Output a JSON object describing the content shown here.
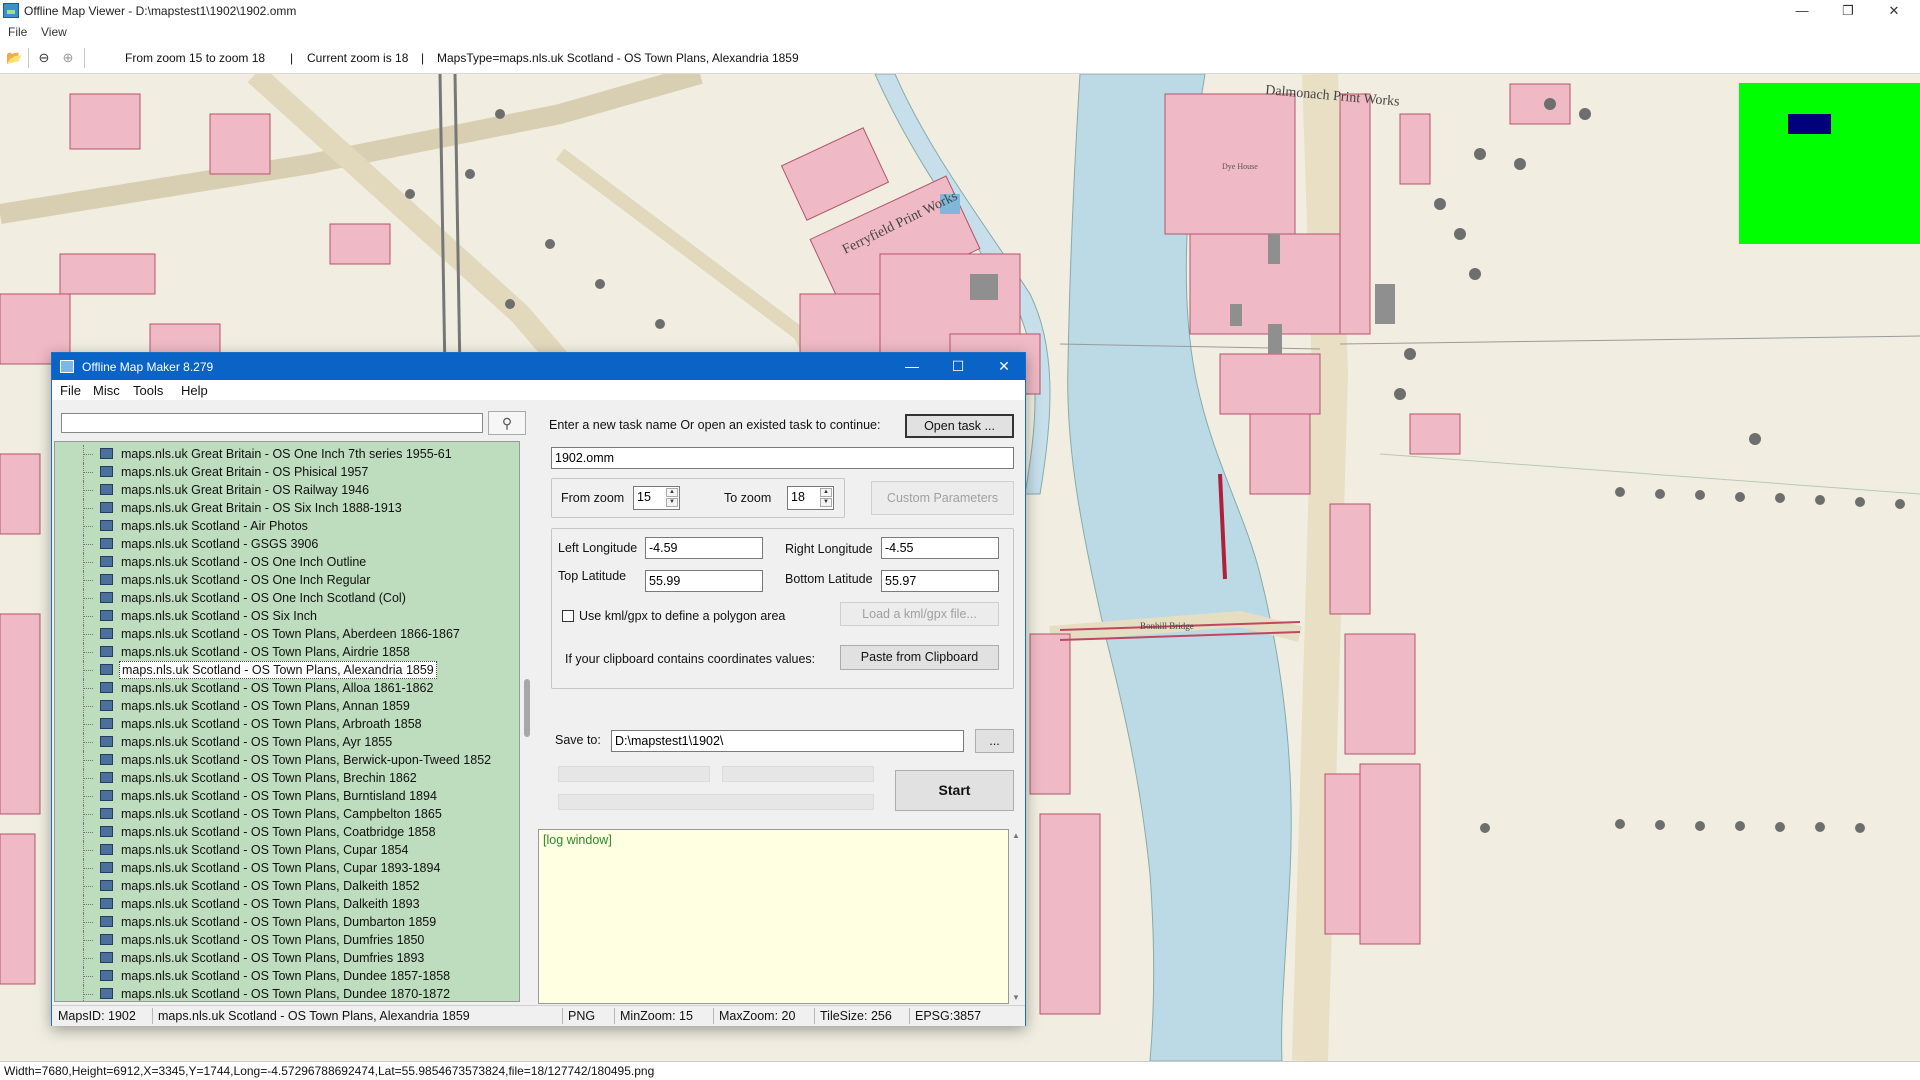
{
  "viewer": {
    "title": "Offline Map Viewer - D:\\mapstest1\\1902\\1902.omm",
    "menu": [
      "File",
      "View"
    ],
    "toolbar": {
      "zoom_range": "From zoom 15 to zoom 18",
      "current_zoom": "Current zoom is 18",
      "maps_type": "MapsType=maps.nls.uk Scotland - OS Town Plans, Alexandria 1859",
      "sep1": "|",
      "sep2": "|"
    },
    "map_labels": {
      "print_works_a": "Dalmonach Print Works",
      "print_works_b": "Ferryfield Print Works",
      "bridge": "Bonhill Bridge",
      "works_small": "Dye House"
    },
    "status": "Width=7680,Height=6912,X=3345,Y=1744,Long=-4.57296788692474,Lat=55.9854673573824,file=18/127742/180495.png",
    "overview_colors": {
      "background": "#00ff00",
      "viewport": "#00007a"
    }
  },
  "dialog": {
    "title": "Offline Map Maker 8.279",
    "menu": [
      "File",
      "Misc",
      "Tools",
      "Help"
    ],
    "search_value": "",
    "maps": [
      "maps.nls.uk Great Britain - OS One Inch 7th series 1955-61",
      "maps.nls.uk Great Britain - OS Phisical 1957",
      "maps.nls.uk Great Britain - OS Railway 1946",
      "maps.nls.uk Great Britain - OS Six Inch 1888-1913",
      "maps.nls.uk Scotland - Air Photos",
      "maps.nls.uk Scotland - GSGS 3906",
      "maps.nls.uk Scotland - OS One Inch Outline",
      "maps.nls.uk Scotland - OS One Inch Regular",
      "maps.nls.uk Scotland - OS One Inch Scotland (Col)",
      "maps.nls.uk Scotland - OS Six Inch",
      "maps.nls.uk Scotland - OS Town Plans, Aberdeen 1866-1867",
      "maps.nls.uk Scotland - OS Town Plans, Airdrie 1858",
      "maps.nls.uk Scotland - OS Town Plans, Alexandria 1859",
      "maps.nls.uk Scotland - OS Town Plans, Alloa 1861-1862",
      "maps.nls.uk Scotland - OS Town Plans, Annan 1859",
      "maps.nls.uk Scotland - OS Town Plans, Arbroath 1858",
      "maps.nls.uk Scotland - OS Town Plans, Ayr 1855",
      "maps.nls.uk Scotland - OS Town Plans, Berwick-upon-Tweed 1852",
      "maps.nls.uk Scotland - OS Town Plans, Brechin 1862",
      "maps.nls.uk Scotland - OS Town Plans, Burntisland 1894",
      "maps.nls.uk Scotland - OS Town Plans, Campbelton 1865",
      "maps.nls.uk Scotland - OS Town Plans, Coatbridge 1858",
      "maps.nls.uk Scotland - OS Town Plans, Cupar 1854",
      "maps.nls.uk Scotland - OS Town Plans, Cupar 1893-1894",
      "maps.nls.uk Scotland - OS Town Plans, Dalkeith 1852",
      "maps.nls.uk Scotland - OS Town Plans, Dalkeith 1893",
      "maps.nls.uk Scotland - OS Town Plans, Dumbarton 1859",
      "maps.nls.uk Scotland - OS Town Plans, Dumfries 1850",
      "maps.nls.uk Scotland - OS Town Plans, Dumfries 1893",
      "maps.nls.uk Scotland - OS Town Plans, Dundee 1857-1858",
      "maps.nls.uk Scotland - OS Town Plans, Dundee 1870-1872"
    ],
    "selected_map": "maps.nls.uk Scotland - OS Town Plans, Alexandria 1859",
    "task_prompt": "Enter a new task name Or open an existed task to continue:",
    "open_task_label": "Open task ...",
    "task_name": "1902.omm",
    "from_zoom_label": "From zoom",
    "from_zoom": "15",
    "to_zoom_label": "To zoom",
    "to_zoom": "18",
    "custom_params_label": "Custom Parameters",
    "left_lon_label": "Left Longitude",
    "left_lon": "-4.59",
    "right_lon_label": "Right Longitude",
    "right_lon": "-4.55",
    "top_lat_label": "Top Latitude",
    "top_lat": "55.99",
    "bottom_lat_label": "Bottom Latitude",
    "bottom_lat": "55.97",
    "kml_label": "Use kml/gpx to define a polygon area",
    "load_kml_label": "Load a kml/gpx file...",
    "clipboard_label": "If your clipboard contains coordinates values:",
    "paste_label": "Paste from Clipboard",
    "save_to_label": "Save to:",
    "save_to": "D:\\mapstest1\\1902\\",
    "browse_label": "...",
    "start_label": "Start",
    "log_text": "[log window]",
    "status": {
      "maps_id": "MapsID: 1902",
      "map_name": "maps.nls.uk Scotland - OS Town Plans, Alexandria 1859",
      "format": "PNG",
      "min_zoom": "MinZoom: 15",
      "max_zoom": "MaxZoom: 20",
      "tile_size": "TileSize: 256",
      "epsg": "EPSG:3857"
    }
  }
}
